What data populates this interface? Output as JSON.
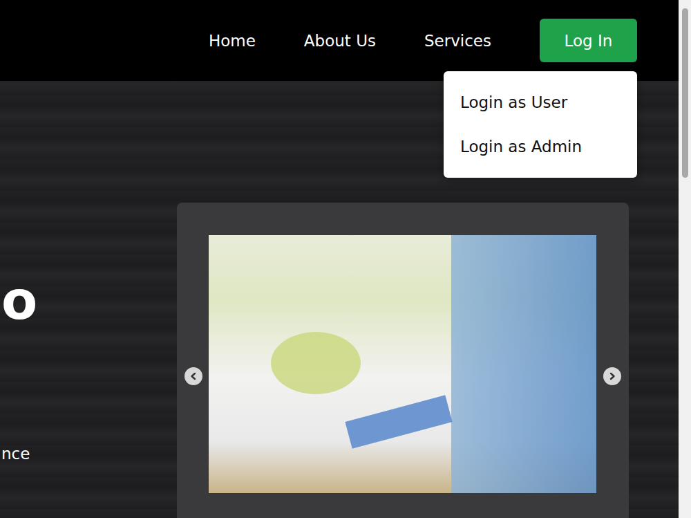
{
  "nav": {
    "items": [
      {
        "label": "Home"
      },
      {
        "label": "About Us"
      },
      {
        "label": "Services"
      }
    ]
  },
  "login": {
    "label": "Log In",
    "expanded": true,
    "menu": [
      {
        "label": "Login as User"
      },
      {
        "label": "Login as Admin"
      }
    ]
  },
  "hero": {
    "heading": "o",
    "text": "nce"
  }
}
